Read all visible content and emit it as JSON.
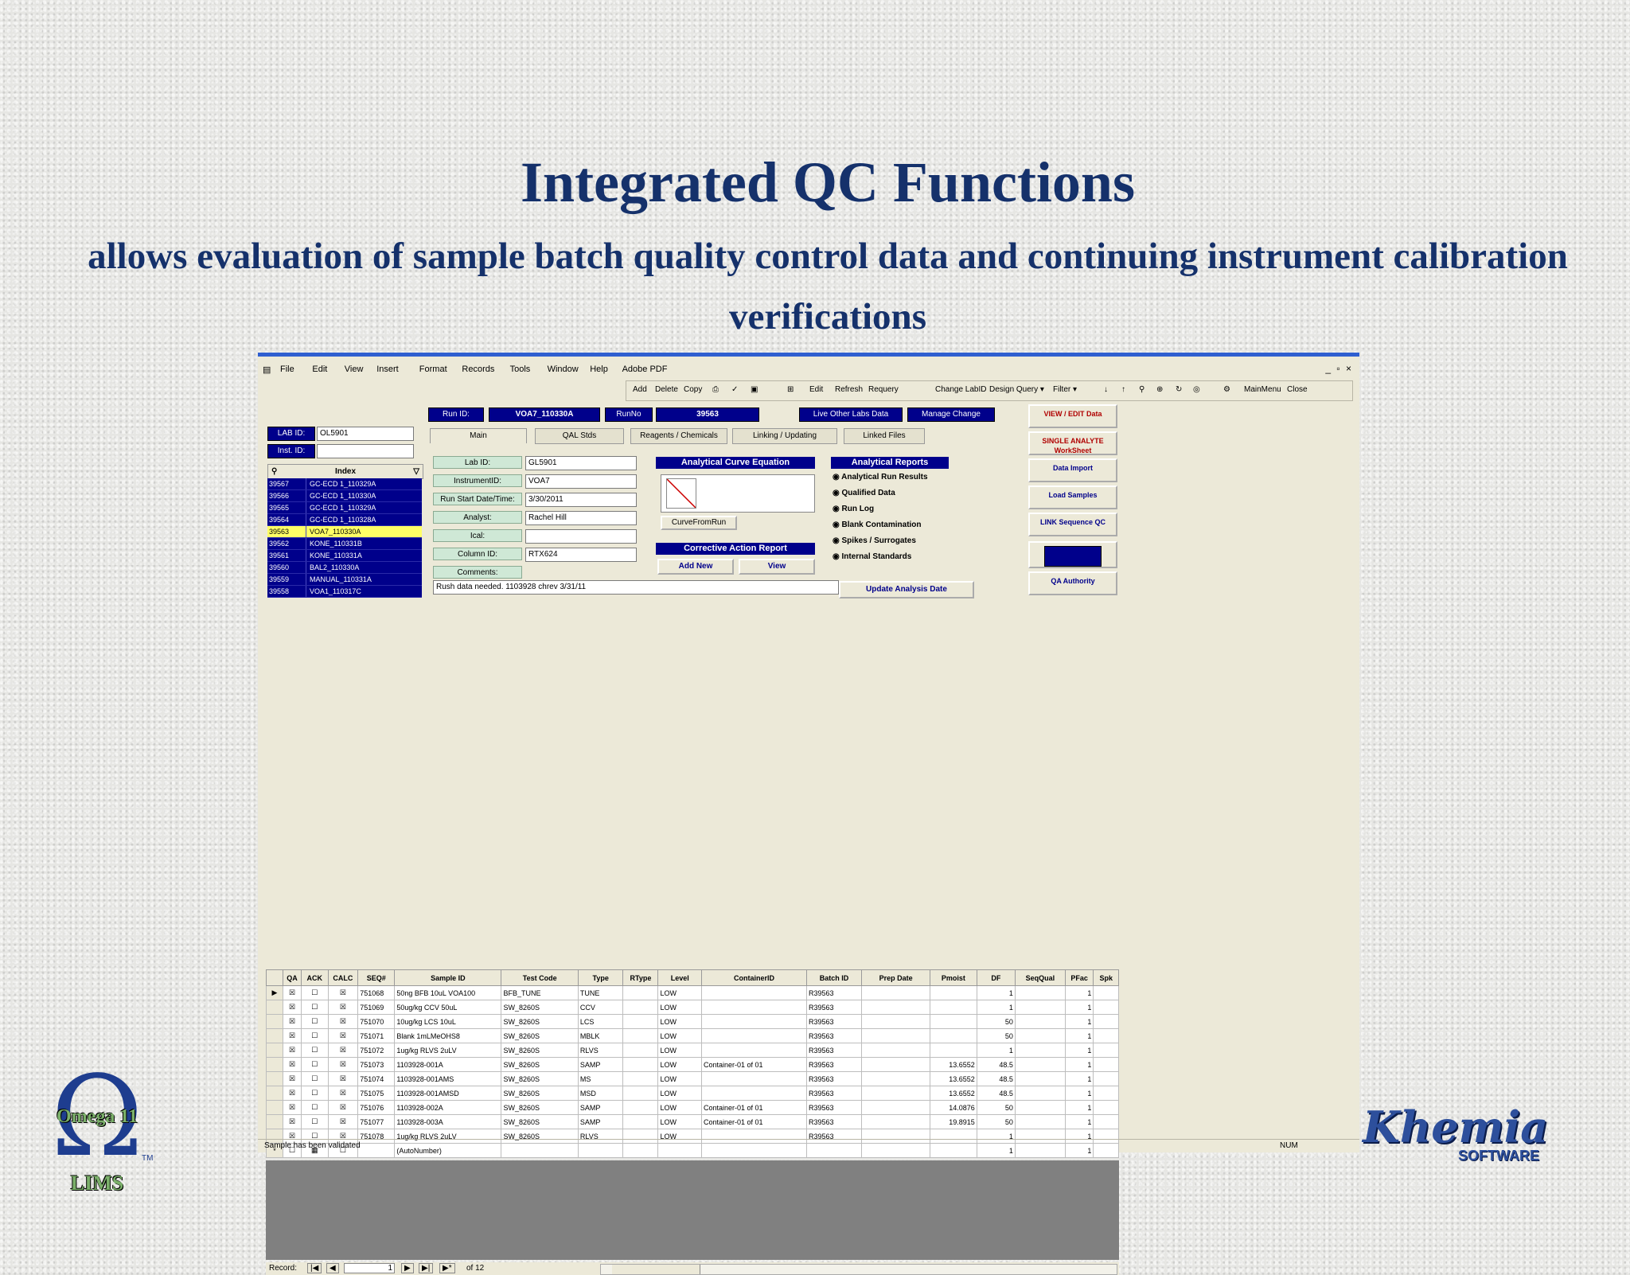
{
  "slide": {
    "title": "Integrated QC Functions",
    "subtitle": "allows evaluation of sample batch quality control data and continuing instrument calibration verifications"
  },
  "menu": [
    "File",
    "Edit",
    "View",
    "Insert",
    "Format",
    "Records",
    "Tools",
    "Window",
    "Help",
    "Adobe PDF"
  ],
  "window_controls": "_ ▫ ×",
  "toolbar": [
    "Add",
    "Delete",
    "Copy",
    "Edit",
    "Refresh",
    "Requery",
    "Change LabID",
    "Design Query ▾",
    "Filter ▾",
    "MainMenu",
    "Close"
  ],
  "run": {
    "run_id_label": "Run ID:",
    "run_id": "VOA7_110330A",
    "run_no_label": "RunNo",
    "run_no": "39563",
    "live_other_labs": "Live Other Labs Data",
    "manage_change": "Manage Change"
  },
  "lab": {
    "lab_id_label": "LAB ID:",
    "lab_id": "OL5901",
    "inst_id_label": "Inst. ID:"
  },
  "index": {
    "header": "Index",
    "rows": [
      [
        "39567",
        "GC-ECD 1_110329A"
      ],
      [
        "39566",
        "GC-ECD 1_110330A"
      ],
      [
        "39565",
        "GC-ECD 1_110329A"
      ],
      [
        "39564",
        "GC-ECD 1_110328A"
      ],
      [
        "39563",
        "VOA7_110330A"
      ],
      [
        "39562",
        "KONE_110331B"
      ],
      [
        "39561",
        "KONE_110331A"
      ],
      [
        "39560",
        "BAL2_110330A"
      ],
      [
        "39559",
        "MANUAL_110331A"
      ],
      [
        "39558",
        "VOA1_110317C"
      ]
    ],
    "selected": 4
  },
  "tabs": [
    "Main",
    "QAL Stds",
    "Reagents / Chemicals",
    "Linking / Updating",
    "Linked Files"
  ],
  "fields": [
    {
      "label": "Lab ID:",
      "value": "GL5901"
    },
    {
      "label": "InstrumentID:",
      "value": "VOA7"
    },
    {
      "label": "Run Start Date/Time:",
      "value": "3/30/2011"
    },
    {
      "label": "Analyst:",
      "value": "Rachel Hill"
    },
    {
      "label": "Ical:",
      "value": ""
    },
    {
      "label": "Column ID:",
      "value": "RTX624"
    },
    {
      "label": "Comments:",
      "value": "Rush data needed. 1103928 chrev 3/31/11"
    }
  ],
  "curve": {
    "header": "Analytical Curve Equation",
    "button": "CurveFromRun"
  },
  "corrective": {
    "header": "Corrective Action Report",
    "add": "Add New",
    "view": "View"
  },
  "reports": {
    "header": "Analytical Reports",
    "items": [
      "Analytical Run Results",
      "Qualified Data",
      "Run Log",
      "Blank Contamination",
      "Spikes / Surrogates",
      "Internal Standards"
    ],
    "update": "Update Analysis Date"
  },
  "side_buttons": [
    "VIEW / EDIT Data",
    "SINGLE ANALYTE WorkSheet",
    "Data Import",
    "Load Samples",
    "LINK Sequence QC",
    "",
    "QA Authority"
  ],
  "grid": {
    "columns": [
      "",
      "QA",
      "ACK",
      "CALC",
      "SEQ#",
      "Sample ID",
      "Test Code",
      "Type",
      "RType",
      "Level",
      "ContainerID",
      "Batch ID",
      "Prep Date",
      "Pmoist",
      "DF",
      "SeqQual",
      "PFac",
      "Spk"
    ],
    "rows": [
      [
        "▶",
        "☒",
        "☐",
        "☒",
        "751068",
        "50ng BFB 10uL VOA100",
        "BFB_TUNE",
        "TUNE",
        "",
        "LOW",
        "",
        "R39563",
        "",
        "",
        "1",
        "",
        "1",
        ""
      ],
      [
        "",
        "☒",
        "☐",
        "☒",
        "751069",
        "50ug/kg CCV 50uL",
        "SW_8260S",
        "CCV",
        "",
        "LOW",
        "",
        "R39563",
        "",
        "",
        "1",
        "",
        "1",
        ""
      ],
      [
        "",
        "☒",
        "☐",
        "☒",
        "751070",
        "10ug/kg LCS 10uL",
        "SW_8260S",
        "LCS",
        "",
        "LOW",
        "",
        "R39563",
        "",
        "",
        "50",
        "",
        "1",
        ""
      ],
      [
        "",
        "☒",
        "☐",
        "☒",
        "751071",
        "Blank 1mLMeOHS8",
        "SW_8260S",
        "MBLK",
        "",
        "LOW",
        "",
        "R39563",
        "",
        "",
        "50",
        "",
        "1",
        ""
      ],
      [
        "",
        "☒",
        "☐",
        "☒",
        "751072",
        "1ug/kg RLVS 2uLV",
        "SW_8260S",
        "RLVS",
        "",
        "LOW",
        "",
        "R39563",
        "",
        "",
        "1",
        "",
        "1",
        ""
      ],
      [
        "",
        "☒",
        "☐",
        "☒",
        "751073",
        "1103928-001A",
        "SW_8260S",
        "SAMP",
        "",
        "LOW",
        "Container-01 of 01",
        "R39563",
        "",
        "13.6552",
        "48.5",
        "",
        "1",
        ""
      ],
      [
        "",
        "☒",
        "☐",
        "☒",
        "751074",
        "1103928-001AMS",
        "SW_8260S",
        "MS",
        "",
        "LOW",
        "",
        "R39563",
        "",
        "13.6552",
        "48.5",
        "",
        "1",
        ""
      ],
      [
        "",
        "☒",
        "☐",
        "☒",
        "751075",
        "1103928-001AMSD",
        "SW_8260S",
        "MSD",
        "",
        "LOW",
        "",
        "R39563",
        "",
        "13.6552",
        "48.5",
        "",
        "1",
        ""
      ],
      [
        "",
        "☒",
        "☐",
        "☒",
        "751076",
        "1103928-002A",
        "SW_8260S",
        "SAMP",
        "",
        "LOW",
        "Container-01 of 01",
        "R39563",
        "",
        "14.0876",
        "50",
        "",
        "1",
        ""
      ],
      [
        "",
        "☒",
        "☐",
        "☒",
        "751077",
        "1103928-003A",
        "SW_8260S",
        "SAMP",
        "",
        "LOW",
        "Container-01 of 01",
        "R39563",
        "",
        "19.8915",
        "50",
        "",
        "1",
        ""
      ],
      [
        "",
        "☒",
        "☐",
        "☒",
        "751078",
        "1ug/kg RLVS 2uLV",
        "SW_8260S",
        "RLVS",
        "",
        "LOW",
        "",
        "R39563",
        "",
        "",
        "1",
        "",
        "1",
        ""
      ],
      [
        "*",
        "☐",
        "▦",
        "☐",
        "",
        "(AutoNumber)",
        "",
        "",
        "",
        "",
        "",
        "",
        "",
        "",
        "1",
        "",
        "1",
        ""
      ]
    ]
  },
  "record_nav": {
    "label": "Record:",
    "current": "1",
    "of": "of 12"
  },
  "status": {
    "text": "Sample has been validated",
    "num": "NUM"
  },
  "logos": {
    "omega_top": "Omega 11",
    "omega_bottom": "LIMS",
    "tm": "TM",
    "khemia": "Khemia",
    "software": "SOFTWARE"
  }
}
